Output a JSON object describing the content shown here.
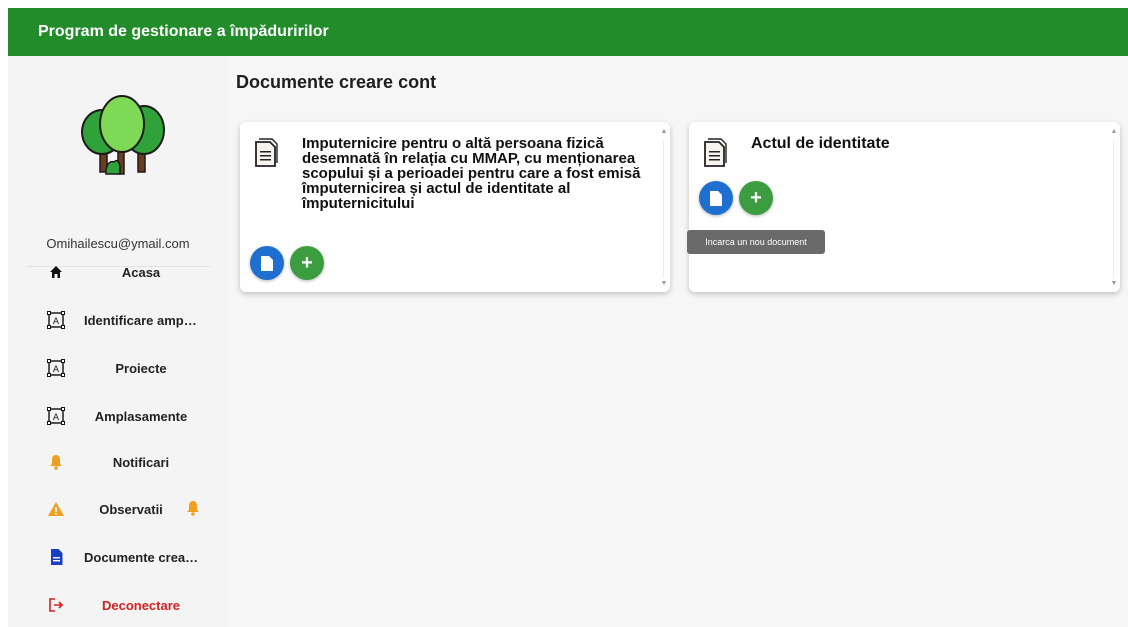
{
  "app": {
    "title": "Program de gestionare a împăduririlor",
    "accent_color": "#238c2a"
  },
  "sidebar": {
    "logo_icon": "trees-logo",
    "email": "Omihailescu@ymail.com",
    "items": [
      {
        "label": "Acasa",
        "icon": "home-icon"
      },
      {
        "label": "Identificare amplasament",
        "icon": "map-frame-icon"
      },
      {
        "label": "Proiecte",
        "icon": "map-frame-icon"
      },
      {
        "label": "Amplasamente",
        "icon": "map-frame-icon"
      },
      {
        "label": "Notificari",
        "icon": "bell-icon"
      },
      {
        "label": "Observatii",
        "icon": "warning-icon",
        "badge_icon": "bell-icon"
      },
      {
        "label": "Documente creare cont",
        "icon": "document-icon"
      },
      {
        "label": "Deconectare",
        "icon": "logout-icon",
        "color": "#d32222"
      }
    ]
  },
  "main": {
    "title": "Documente creare cont",
    "cards": [
      {
        "title": "Imputernicire pentru o altă persoana fizică desemnată în relația cu MMAP, cu menționarea scopului și a perioadei pentru care a fost emisă împuternicirea și actul de identitate al împuternicitului",
        "icon": "document-outline-icon"
      },
      {
        "title": "Actul de identitate",
        "icon": "document-outline-icon"
      }
    ],
    "tooltip": "Incarca un nou document"
  }
}
